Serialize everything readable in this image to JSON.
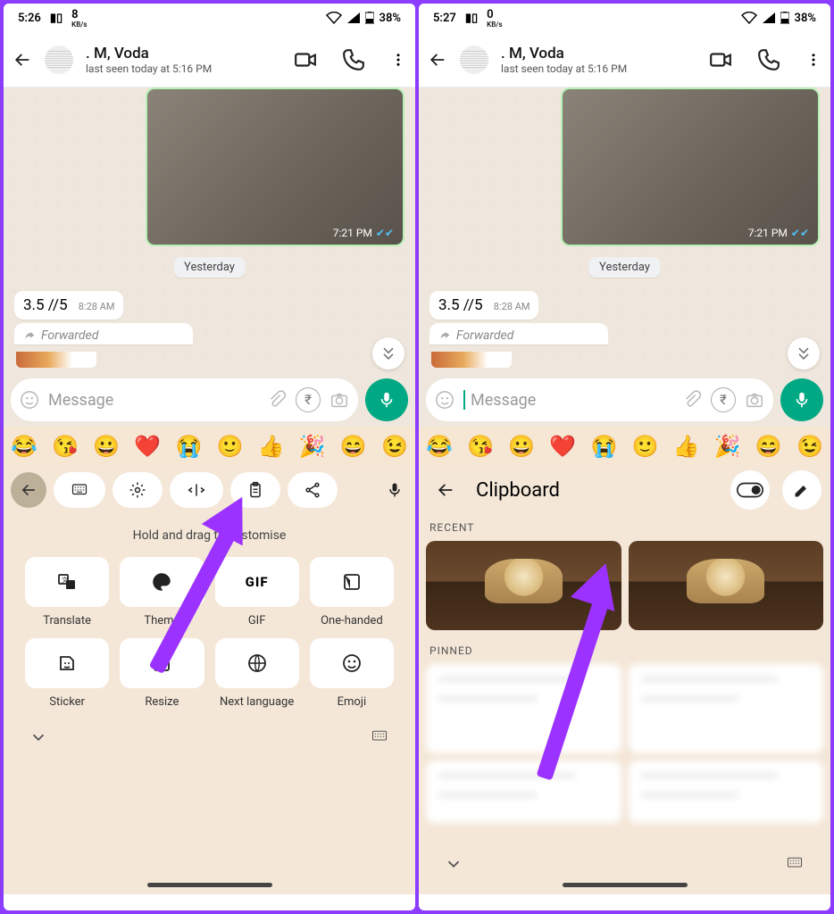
{
  "screens": [
    {
      "statusbar": {
        "time": "5:26",
        "speed_value": "8",
        "speed_unit": "KB/s",
        "battery": "38%"
      },
      "chat_header": {
        "name": ". M, Voda",
        "last_seen": "last seen today at 5:16 PM"
      },
      "chat": {
        "img_time": "7:21 PM",
        "date_chip": "Yesterday",
        "in_text": "3.5 //5",
        "in_time": "8:28 AM",
        "forwarded": "Forwarded"
      },
      "input": {
        "placeholder": "Message"
      },
      "emoji_row": [
        "😂",
        "😘",
        "😀",
        "❤️",
        "😭",
        "🙂",
        "👍",
        "🎉",
        "😄",
        "😉"
      ],
      "keyboard": {
        "hint": "Hold and drag to customise",
        "grid": [
          "Translate",
          "Theme",
          "GIF",
          "One-handed",
          "Sticker",
          "Resize",
          "Next language",
          "Emoji"
        ]
      }
    },
    {
      "statusbar": {
        "time": "5:27",
        "speed_value": "0",
        "speed_unit": "KB/s",
        "battery": "38%"
      },
      "chat_header": {
        "name": ". M, Voda",
        "last_seen": "last seen today at 5:16 PM"
      },
      "chat": {
        "img_time": "7:21 PM",
        "date_chip": "Yesterday",
        "in_text": "3.5 //5",
        "in_time": "8:28 AM",
        "forwarded": "Forwarded"
      },
      "input": {
        "placeholder": "Message"
      },
      "emoji_row": [
        "😂",
        "😘",
        "😀",
        "❤️",
        "😭",
        "🙂",
        "👍",
        "🎉",
        "😄",
        "😉"
      ],
      "clipboard": {
        "title": "Clipboard",
        "recent_label": "RECENT",
        "pinned_label": "PINNED"
      }
    }
  ]
}
